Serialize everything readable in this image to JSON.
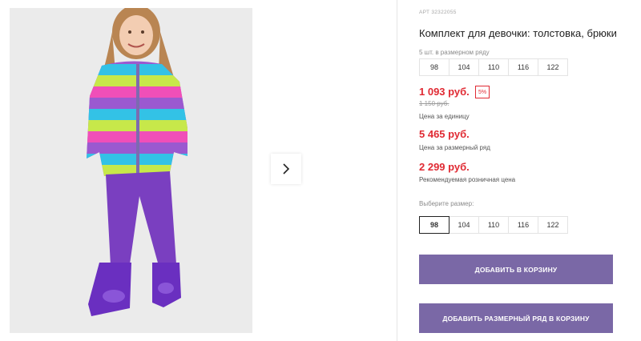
{
  "product": {
    "article": "АРТ 32322055",
    "title": "Комплект для девочки: толстовка, брюки",
    "set_note": "5 шт. в размерном ряду"
  },
  "size_row": [
    "98",
    "104",
    "110",
    "116",
    "122"
  ],
  "prices": {
    "unit_price": "1 093 руб.",
    "discount_badge": "5%",
    "old_price": "1 150 руб.",
    "unit_caption": "Цена за единицу",
    "set_price": "5 465 руб.",
    "set_caption": "Цена за размерный ряд",
    "retail_price": "2 299 руб.",
    "retail_caption": "Рекомендуемая розничная цена"
  },
  "size_select": {
    "label": "Выберите размер:",
    "options": [
      "98",
      "104",
      "110",
      "116",
      "122"
    ],
    "selected": "98"
  },
  "actions": {
    "add_to_cart": "ДОБАВИТЬ В КОРЗИНУ",
    "add_set_to_cart": "ДОБАВИТЬ РАЗМЕРНЫЙ РЯД В КОРЗИНУ"
  },
  "colors": {
    "price_red": "#e02a33",
    "button_purple": "#7a68a6"
  },
  "gallery": {
    "next_icon": "chevron-right-icon"
  }
}
